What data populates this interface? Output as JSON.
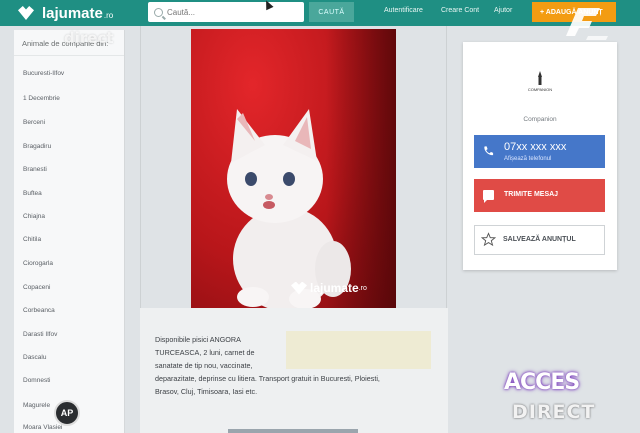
{
  "header": {
    "logo_text": "lajumate",
    "logo_tld": ".ro",
    "search_placeholder": "Caută...",
    "search_button": "CAUTĂ",
    "nav": [
      "Autentificare",
      "Creare Cont",
      "Ajutor"
    ],
    "add_button": "+ ADAUGĂ ANUNȚ"
  },
  "sidebar": {
    "title": "Animale de companie din:",
    "items": [
      "Bucuresti-Ilfov",
      "1 Decembrie",
      "Berceni",
      "Bragadiru",
      "Branesti",
      "Buftea",
      "Chiajna",
      "Chitila",
      "Ciorogarla",
      "Copaceni",
      "Corbeanca",
      "Darasti Ilfov",
      "Dascalu",
      "Domnesti",
      "Magurele",
      "Moara Vlasiei"
    ]
  },
  "listing": {
    "watermark_text": "lajumate",
    "watermark_tld": ".ro",
    "description_lines": [
      "Disponibile pisici ANGORA",
      "TURCEASCA, 2 luni, carnet de",
      "sanatate de tip nou, vaccinate,",
      "deparazitate, deprinse cu litiera. Transport gratuit in Bucuresti, Ploiesti,",
      "Brasov, Cluj, Timisoara, Iasi etc."
    ]
  },
  "seller": {
    "logo_label": "COMPANION",
    "name": "Companion",
    "phone": "07xx xxx xxx",
    "phone_sub": "Afișează telefonul",
    "message_button": "TRIMITE MESAJ",
    "save_button": "SALVEAZĂ ANUNȚUL"
  },
  "overlay": {
    "direct_watermark": "direct",
    "acces_top": "ACCES",
    "acces_bottom": "DIRECT",
    "ap_badge": "AP"
  },
  "colors": {
    "topbar": "#1f8f83",
    "add_button": "#f39c12",
    "phone_button": "#4577c9",
    "message_button": "#e04b46"
  }
}
